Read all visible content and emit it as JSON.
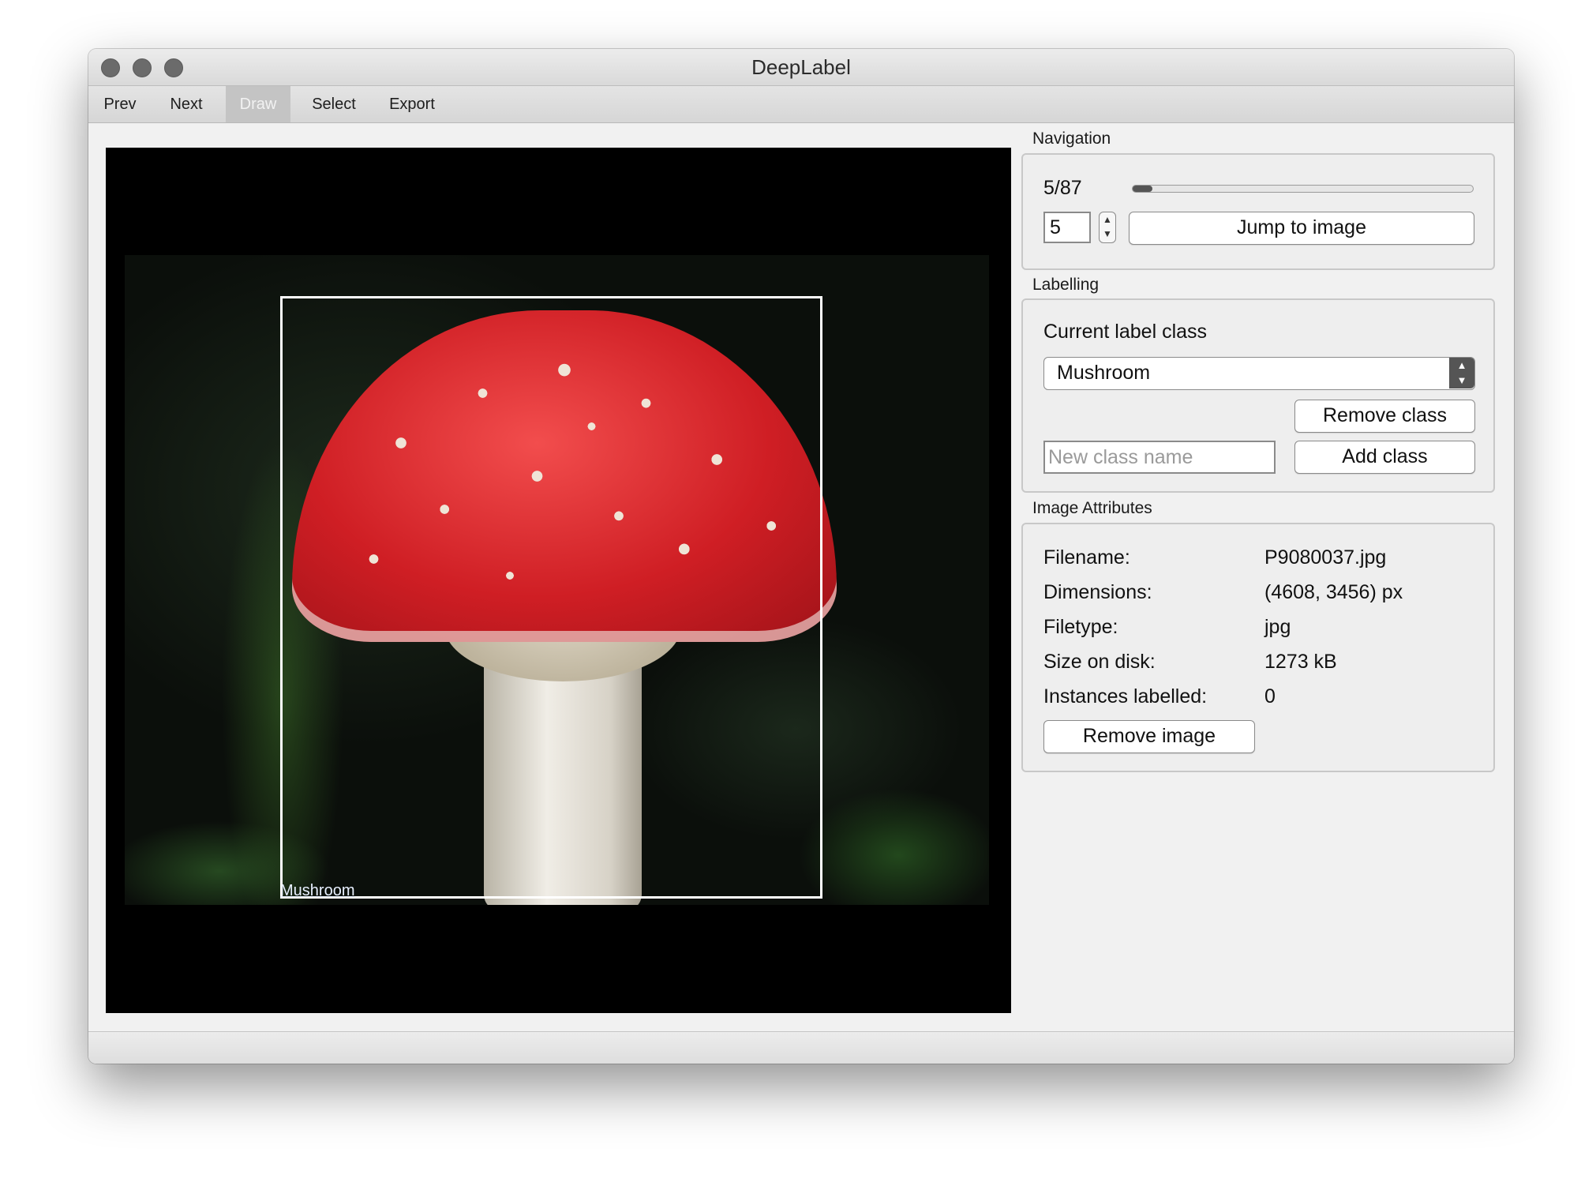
{
  "window": {
    "title": "DeepLabel"
  },
  "toolbar": {
    "prev": "Prev",
    "next": "Next",
    "draw": "Draw",
    "select": "Select",
    "export": "Export"
  },
  "viewer": {
    "box_label": "Mushroom"
  },
  "navigation": {
    "title": "Navigation",
    "position_text": "5/87",
    "progress": 0.057,
    "spin_value": "5",
    "jump_label": "Jump to image"
  },
  "labelling": {
    "title": "Labelling",
    "current_label": "Current label class",
    "selected_class": "Mushroom",
    "remove_class": "Remove class",
    "new_class_placeholder": "New class name",
    "add_class": "Add class"
  },
  "attributes": {
    "title": "Image Attributes",
    "rows": [
      {
        "key": "Filename:",
        "value": "P9080037.jpg"
      },
      {
        "key": "Dimensions:",
        "value": "(4608, 3456) px"
      },
      {
        "key": "Filetype:",
        "value": "jpg"
      },
      {
        "key": "Size on disk:",
        "value": "1273 kB"
      },
      {
        "key": "Instances labelled:",
        "value": "0"
      }
    ],
    "remove_image": "Remove image"
  }
}
